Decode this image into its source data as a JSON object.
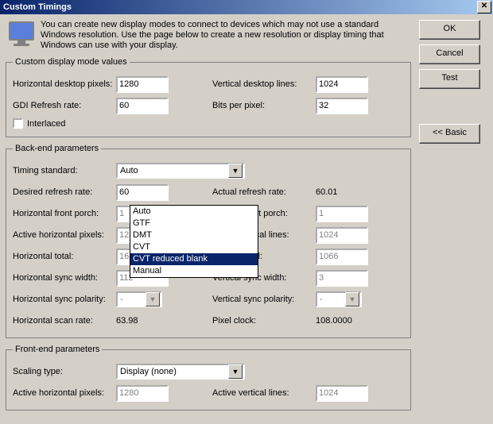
{
  "title": "Custom Timings",
  "description": "You can create new display modes to connect to devices which may not use a standard Windows resolution. Use the page below to create a new resolution or display timing that Windows can use with your display.",
  "buttons": {
    "ok": "OK",
    "cancel": "Cancel",
    "test": "Test",
    "basic": "<< Basic"
  },
  "groups": {
    "customValues": "Custom display mode values",
    "backEnd": "Back-end parameters",
    "frontEnd": "Front-end parameters"
  },
  "labels": {
    "hDesktopPixels": "Horizontal desktop pixels:",
    "vDesktopLines": "Vertical desktop lines:",
    "gdiRefresh": "GDI Refresh rate:",
    "bitsPerPixel": "Bits per pixel:",
    "interlaced": "Interlaced",
    "timingStandard": "Timing standard:",
    "desiredRefresh": "Desired refresh rate:",
    "actualRefresh": "Actual refresh rate:",
    "hFrontPorch": "Horizontal front porch:",
    "vFrontPorch": "Vertical front porch:",
    "activeHPixels": "Active horizontal pixels:",
    "activeVLines": "Active vertical lines:",
    "hTotal": "Horizontal total:",
    "vTotal": "Vertical total:",
    "hSyncWidth": "Horizontal sync width:",
    "vSyncWidth": "Vertical sync width:",
    "hSyncPol": "Horizontal sync polarity:",
    "vSyncPol": "Vertical sync polarity:",
    "hScanRate": "Horizontal scan rate:",
    "pixelClock": "Pixel clock:",
    "scalingType": "Scaling type:",
    "feActiveH": "Active horizontal pixels:",
    "feActiveV": "Active vertical lines:"
  },
  "values": {
    "hDesktopPixels": "1280",
    "vDesktopLines": "1024",
    "gdiRefresh": "60",
    "bitsPerPixel": "32",
    "timingStandard": "Auto",
    "desiredRefresh": "60",
    "actualRefresh": "60.01",
    "hFrontPorch": "1",
    "vFrontPorch": "1",
    "activeHPixels": "1280",
    "activeVLines": "1024",
    "hTotal": "1688",
    "vTotal": "1066",
    "hSyncWidth": "112",
    "vSyncWidth": "3",
    "hSyncPol": "-",
    "vSyncPol": "-",
    "hScanRate": "63.98",
    "pixelClock": "108.0000",
    "scalingType": "Display (none)",
    "feActiveH": "1280",
    "feActiveV": "1024"
  },
  "timing_options": [
    "Auto",
    "GTF",
    "DMT",
    "CVT",
    "CVT reduced blank",
    "Manual"
  ]
}
